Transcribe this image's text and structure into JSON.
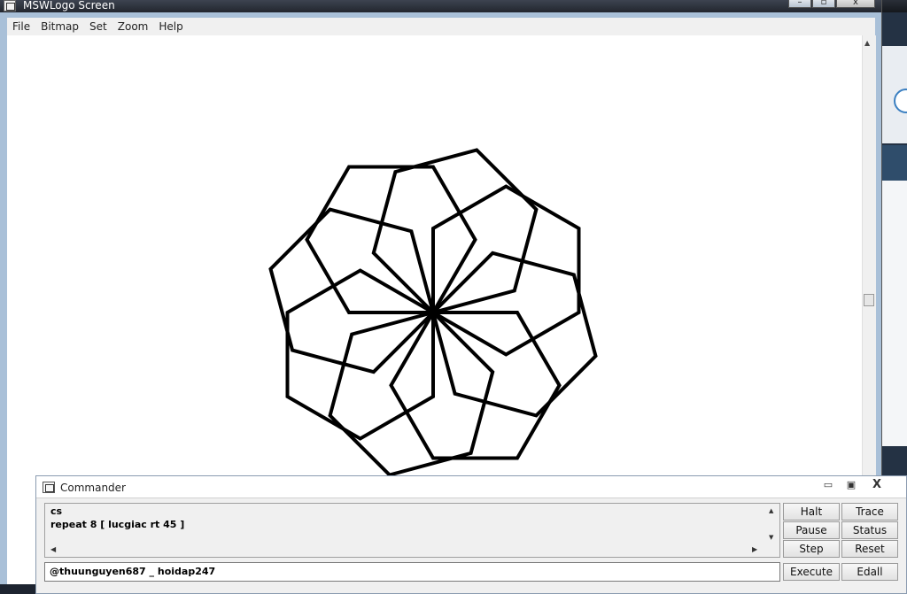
{
  "main_window": {
    "title": "MSWLogo Screen",
    "controls": [
      "–",
      "▫",
      "x"
    ]
  },
  "menu": [
    "File",
    "Bitmap",
    "Set",
    "Zoom",
    "Help"
  ],
  "canvas": {
    "drawing_color": "#000000",
    "background": "#ffffff"
  },
  "commander": {
    "title": "Commander",
    "controls": [
      "▭",
      "▣",
      "X"
    ],
    "history": [
      "cs",
      "repeat 8 [ lucgiac rt 45 ]"
    ],
    "input_value": "@thuunguyen687 _ hoidap247",
    "buttons": {
      "halt": "Halt",
      "trace": "Trace",
      "pause": "Pause",
      "status": "Status",
      "step": "Step",
      "reset": "Reset",
      "execute": "Execute",
      "edall": "Edall"
    }
  }
}
